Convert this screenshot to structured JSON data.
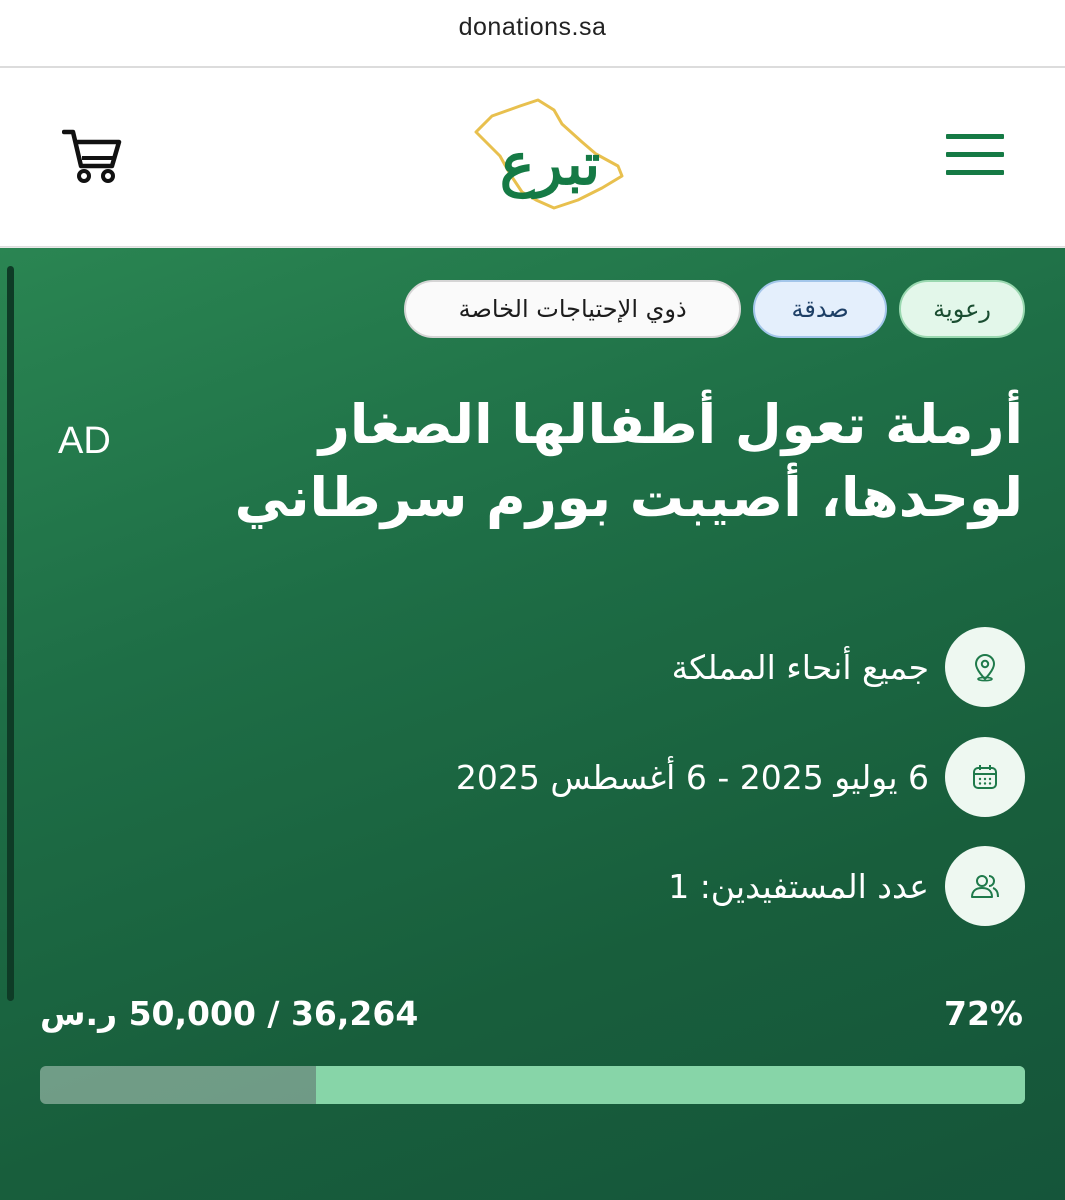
{
  "browser": {
    "url": "donations.sa"
  },
  "header": {
    "logo_text": "تبرع",
    "cart_icon": "cart-icon",
    "menu_icon": "hamburger-menu-icon"
  },
  "tags": [
    {
      "label": "رعوية"
    },
    {
      "label": "صدقة"
    },
    {
      "label": "ذوي الإحتياجات الخاصة"
    }
  ],
  "ad_label": "AD",
  "campaign": {
    "title": "أرملة تعول أطفالها الصغار لوحدها، أصيبت بورم سرطاني",
    "location": "جميع أنحاء المملكة",
    "dates": "6 يوليو 2025 - 6 أغسطس 2025",
    "beneficiaries": "عدد المستفيدين: 1",
    "percent_label": "72%",
    "amount_label": "36,264 / 50,000 ر.س",
    "progress_fraction": 0.72
  },
  "colors": {
    "brand_green": "#157a45",
    "hero_green": "#1e6e46",
    "progress_fill": "#87d5a8",
    "logo_gold": "#e8c04e"
  }
}
